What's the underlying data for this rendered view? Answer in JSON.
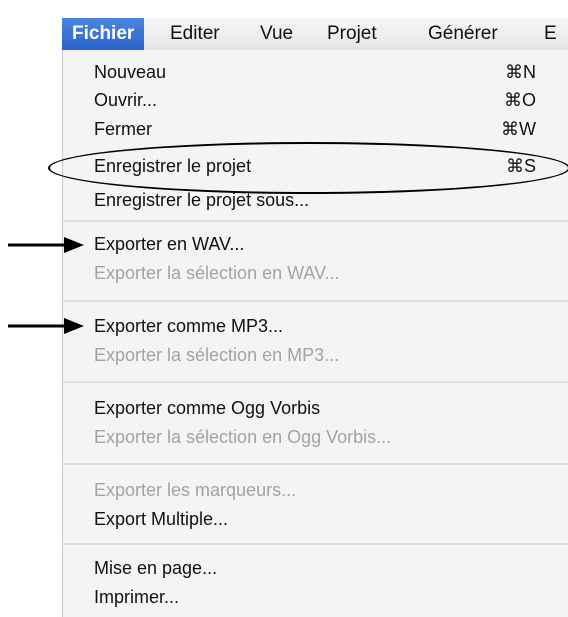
{
  "menubar": {
    "items": [
      {
        "label": "Fichier",
        "active": true
      },
      {
        "label": "Editer"
      },
      {
        "label": "Vue"
      },
      {
        "label": "Projet"
      },
      {
        "label": "Générer"
      },
      {
        "label": "E"
      }
    ]
  },
  "menu": {
    "groups": [
      {
        "items": [
          {
            "label": "Nouveau",
            "shortcut": "⌘N",
            "enabled": true
          },
          {
            "label": "Ouvrir...",
            "shortcut": "⌘O",
            "enabled": true
          },
          {
            "label": "Fermer",
            "shortcut": "⌘W",
            "enabled": true
          },
          {
            "label": "Enregistrer le projet",
            "shortcut": "⌘S",
            "enabled": true
          },
          {
            "label": "Enregistrer le projet sous...",
            "enabled": true
          }
        ]
      },
      {
        "items": [
          {
            "label": "Exporter en WAV...",
            "enabled": true
          },
          {
            "label": "Exporter la sélection en WAV...",
            "enabled": false
          }
        ]
      },
      {
        "items": [
          {
            "label": "Exporter comme MP3...",
            "enabled": true
          },
          {
            "label": "Exporter la sélection en MP3...",
            "enabled": false
          }
        ]
      },
      {
        "items": [
          {
            "label": "Exporter comme Ogg Vorbis",
            "enabled": true
          },
          {
            "label": "Exporter la sélection en Ogg Vorbis...",
            "enabled": false
          }
        ]
      },
      {
        "items": [
          {
            "label": "Exporter les marqueurs...",
            "enabled": false
          },
          {
            "label": "Export Multiple...",
            "enabled": true
          }
        ]
      },
      {
        "items": [
          {
            "label": "Mise en page...",
            "enabled": true
          },
          {
            "label": "Imprimer...",
            "enabled": true
          }
        ]
      }
    ]
  },
  "annotations": {
    "highlighted_item": "Enregistrer le projet",
    "arrow_targets": [
      "Exporter en WAV...",
      "Exporter comme MP3..."
    ],
    "annotation_color": "#000000"
  },
  "colors": {
    "menu_background": "#f4f4f4",
    "selected_menu_title": "#2f6bd1",
    "disabled_text": "#a3a3a3",
    "enabled_text": "#111111"
  }
}
